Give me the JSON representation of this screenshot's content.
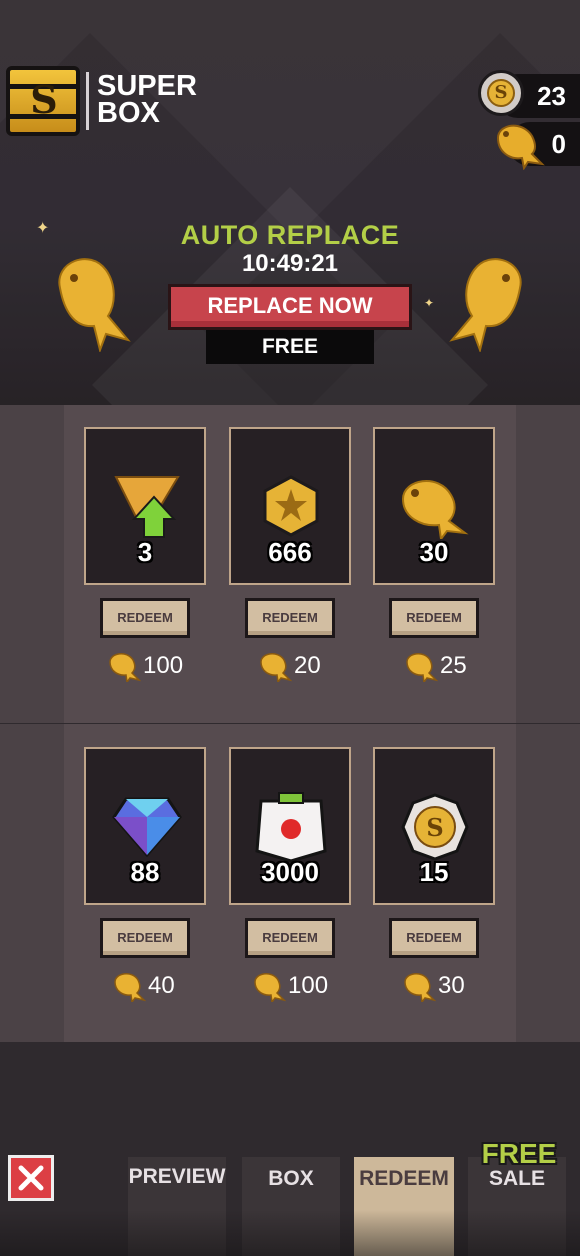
{
  "header": {
    "title_line1": "SUPER",
    "title_line2": "BOX",
    "coins": "23",
    "fish": "0"
  },
  "replace": {
    "auto_label": "AUTO REPLACE",
    "timer": "10:49:21",
    "button_label": "REPLACE NOW",
    "cost_label": "FREE"
  },
  "items": [
    {
      "reward": "rank-up-icon",
      "qty": "3",
      "redeem_label": "REDEEM",
      "price": "100"
    },
    {
      "reward": "star-coin-icon",
      "qty": "666",
      "redeem_label": "REDEEM",
      "price": "20"
    },
    {
      "reward": "fish-icon",
      "qty": "30",
      "redeem_label": "REDEEM",
      "price": "25"
    },
    {
      "reward": "gem-icon",
      "qty": "88",
      "redeem_label": "REDEEM",
      "price": "40"
    },
    {
      "reward": "box-icon",
      "qty": "3000",
      "redeem_label": "REDEEM",
      "price": "100"
    },
    {
      "reward": "super-coin-icon",
      "qty": "15",
      "redeem_label": "REDEEM",
      "price": "30"
    }
  ],
  "nav": {
    "tabs": [
      {
        "label": "PREVIEW",
        "active": false
      },
      {
        "label": "BOX",
        "active": false
      },
      {
        "label": "REDEEM",
        "active": true
      },
      {
        "label": "SALE",
        "active": false
      }
    ],
    "sale_badge": "FREE"
  },
  "colors": {
    "accent_green": "#b3cf47",
    "replace_red": "#c7444c",
    "redeem_tan": "#d2bea2",
    "gold": "#e6b336"
  }
}
